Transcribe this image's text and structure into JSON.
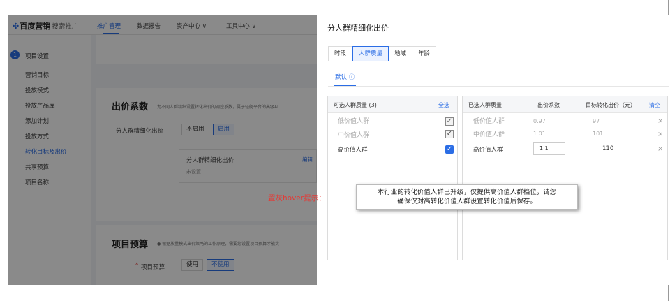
{
  "app": {
    "logo_brand": "百度营销",
    "logo_sub": "搜索推广",
    "nav": [
      {
        "label": "推广管理",
        "active": true
      },
      {
        "label": "数据报告",
        "active": false
      },
      {
        "label": "资产中心 ∨",
        "active": false
      },
      {
        "label": "工具中心 ∨",
        "active": false
      }
    ],
    "sidebar": {
      "step_number": "1",
      "step_title": "项目设置",
      "items": [
        "营销目标",
        "投放模式",
        "投放产品库",
        "添加计划",
        "投放方式",
        "转化目标及出价",
        "共享预算",
        "项目名称"
      ],
      "active_index": 5
    },
    "bid": {
      "title": "出价系数",
      "desc": "为不同人群精细设置转化出价的调控系数，属于轻舸平台的高级AI",
      "row_label": "分人群精细化出价",
      "options": [
        "不启用",
        "启用"
      ],
      "selected": "启用",
      "sub_title": "分人群精细化出价",
      "sub_status": "未设置",
      "sub_edit": "编辑"
    },
    "budget": {
      "title": "项目预算",
      "desc": "● 根据放量模式出价策略的工作原理，需要您设置项目预算才能实",
      "required_mark": "*",
      "row_label": "项目预算",
      "options": [
        "使用",
        "不使用"
      ],
      "selected": "不使用"
    }
  },
  "drawer": {
    "title": "分人群精细化出价",
    "tabs": [
      "时段",
      "人群质量",
      "地域",
      "年龄"
    ],
    "active_tab": "人群质量",
    "subtab": "默认 ⓘ",
    "left_box": {
      "header": "可选人群质量 (3)",
      "select_all": "全选",
      "rows": [
        {
          "label": "低价值人群",
          "checked": true,
          "disabled": true
        },
        {
          "label": "中价值人群",
          "checked": true,
          "disabled": true
        },
        {
          "label": "高价值人群",
          "checked": true,
          "disabled": false
        }
      ]
    },
    "right_box": {
      "headers": [
        "已选人群质量",
        "出价系数",
        "目标转化出价（元）"
      ],
      "clear": "清空",
      "rows": [
        {
          "label": "低价值人群",
          "coef": "0.97",
          "target": "97",
          "muted": true,
          "editable": false
        },
        {
          "label": "中价值人群",
          "coef": "1.01",
          "target": "101",
          "muted": true,
          "editable": false
        },
        {
          "label": "高价值人群",
          "coef": "1.1",
          "target": "110",
          "muted": false,
          "editable": true
        }
      ],
      "remove_icon": "×"
    }
  },
  "tooltip": {
    "line1": "本行业的转化价值人群已升级，仅提供高价值人群档位，请您",
    "line2": "确保仅对高转化价值人群设置转化价值后保存。"
  },
  "annotation": "置灰hover提示：",
  "colors": {
    "accent": "#2b6de5",
    "annotation": "#e53935"
  }
}
